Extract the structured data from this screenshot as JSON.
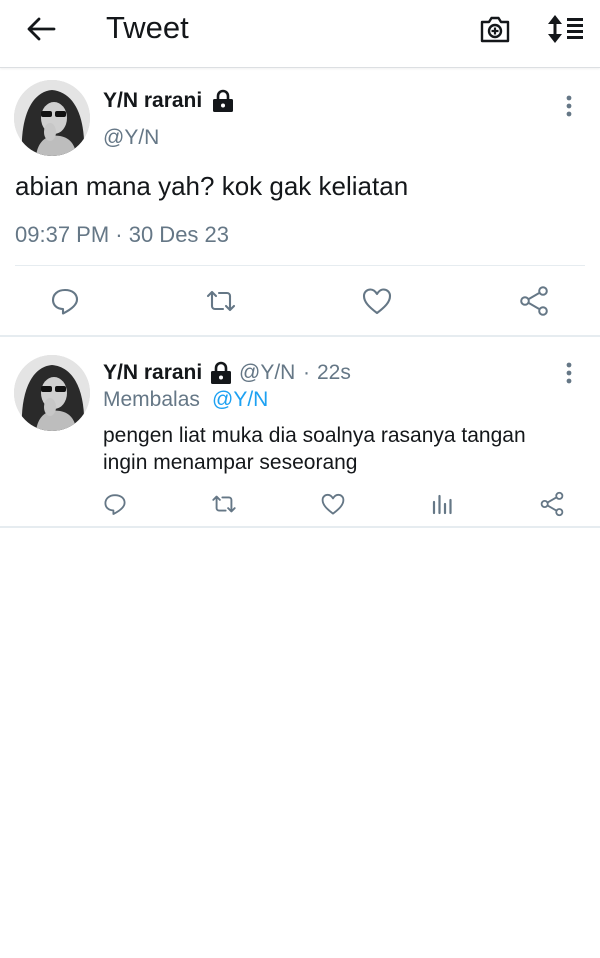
{
  "header": {
    "title": "Tweet",
    "icons": [
      "back-arrow-icon",
      "camera-icon",
      "sort-icon"
    ]
  },
  "main_tweet": {
    "display_name": "Y/N rarani",
    "handle": "@Y/N",
    "text": "abian mana yah? kok gak keliatan",
    "timestamp": "09:37 PM · 30 Des 23",
    "actions": [
      "reply-icon",
      "retweet-icon",
      "like-icon",
      "share-icon"
    ]
  },
  "reply": {
    "display_name": "Y/N rarani",
    "handle": "@Y/N",
    "separator": "·",
    "age": "22s",
    "replying_to_prefix": "Membalas",
    "replying_to_handle": "@Y/N",
    "text": "pengen liat muka dia soalnya rasanya tangan ingin menampar seseorang",
    "actions": [
      "reply-icon",
      "retweet-icon",
      "like-icon",
      "analytics-icon",
      "share-icon"
    ]
  },
  "colors": {
    "text": "#14171a",
    "secondary_text": "#657786",
    "link": "#1da1f2",
    "divider": "#e6ecf0",
    "background": "#ffffff"
  }
}
